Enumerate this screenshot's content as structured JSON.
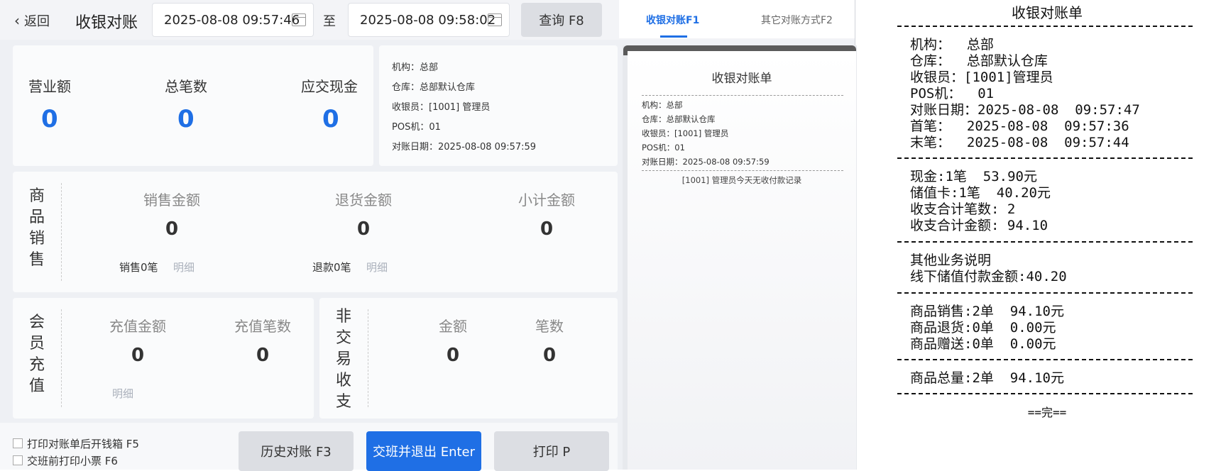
{
  "header": {
    "back_label": "返回",
    "title": "收银对账",
    "start_datetime": "2025-08-08 09:57:46",
    "to_label": "至",
    "end_datetime": "2025-08-08 09:58:02",
    "query_label": "查询 F8"
  },
  "tabs": [
    {
      "label": "收银对账F1",
      "active": true
    },
    {
      "label": "其它对账方式F2",
      "active": false
    }
  ],
  "summary": {
    "revenue_label": "营业额",
    "revenue_value": "0",
    "count_label": "总笔数",
    "count_value": "0",
    "cash_label": "应交现金",
    "cash_value": "0"
  },
  "info": {
    "org": "机构：总部",
    "warehouse": "仓库：总部默认仓库",
    "cashier": "收银员：[1001] 管理员",
    "pos": "POS机：01",
    "date": "对账日期：2025-08-08 09:57:59"
  },
  "goods": {
    "side_label": [
      "商",
      "品",
      "销",
      "售"
    ],
    "sales_label": "销售金额",
    "sales_value": "0",
    "refund_label": "退货金额",
    "refund_value": "0",
    "subtotal_label": "小计金额",
    "subtotal_value": "0",
    "sales_count": "销售0笔",
    "refund_count": "退款0笔",
    "detail": "明细"
  },
  "member": {
    "side_label": [
      "会",
      "员",
      "充",
      "值"
    ],
    "amount_label": "充值金额",
    "amount_value": "0",
    "count_label": "充值笔数",
    "count_value": "0",
    "detail": "明细"
  },
  "non_trade": {
    "side_label": [
      "非",
      "交",
      "易",
      "收",
      "支"
    ],
    "amount_label": "金额",
    "amount_value": "0",
    "count_label": "笔数",
    "count_value": "0"
  },
  "options": {
    "open_drawer": "打印对账单后开钱箱 F5",
    "print_ticket": "交班前打印小票 F6"
  },
  "buttons": {
    "history": "历史对账 F3",
    "handover": "交班并退出 Enter",
    "print": "打印 P"
  },
  "preview": {
    "title": "收银对账单",
    "org": "机构：总部",
    "warehouse": "仓库：总部默认仓库",
    "cashier": "收银员：[1001] 管理员",
    "pos": "POS机：01",
    "date": "对账日期：2025-08-08 09:57:59",
    "note": "[1001] 管理员今天无收付款记录"
  },
  "receipt": {
    "title": "收银对账单",
    "sep": "------------------------------------------",
    "lines1": [
      "机构：  总部",
      "仓库：  总部默认仓库",
      "收银员：[1001]管理员",
      "POS机：  01",
      "对账日期：2025-08-08  09:57:47",
      "首笔：  2025-08-08  09:57:36",
      "末笔：  2025-08-08  09:57:44"
    ],
    "lines2": [
      "现金:1笔  53.90元",
      "储值卡:1笔  40.20元",
      "收支合计笔数: 2",
      "收支合计金额: 94.10"
    ],
    "lines3": [
      "其他业务说明",
      "线下储值付款金额:40.20"
    ],
    "lines4": [
      "商品销售:2单  94.10元",
      "商品退货:0单  0.00元",
      "商品赠送:0单  0.00元"
    ],
    "lines5": [
      "商品总量:2单  94.10元"
    ],
    "end": "==完=="
  },
  "colors": {
    "accent": "#1f6fe5",
    "panel": "#fafbfc",
    "background": "#eef0f4"
  }
}
